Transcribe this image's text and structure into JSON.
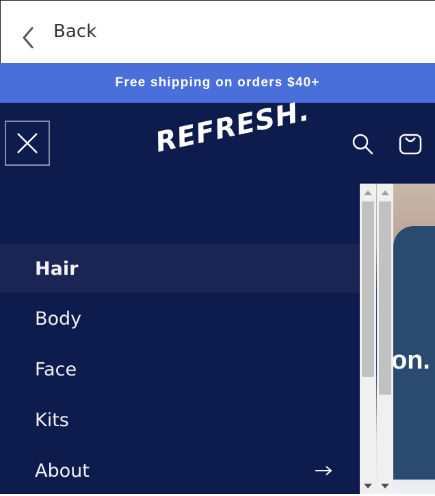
{
  "topbar": {
    "back_label": "Back"
  },
  "announcement": {
    "text": "Free shipping on orders $40+"
  },
  "header": {
    "logo": "REFRESH."
  },
  "menu": {
    "items": [
      {
        "label": "Hair"
      },
      {
        "label": "Body"
      },
      {
        "label": "Face"
      },
      {
        "label": "Kits"
      },
      {
        "label": "About"
      }
    ]
  },
  "side_image": {
    "text": "on."
  },
  "icons": {
    "back": "chevron-left-icon",
    "close": "close-icon",
    "search": "search-icon",
    "cart": "cart-icon",
    "arrow": "arrow-right-icon"
  },
  "colors": {
    "announcement_bg": "#4a6fdb",
    "header_bg": "#0e1b4d",
    "active_item_bg": "#1a2553"
  }
}
